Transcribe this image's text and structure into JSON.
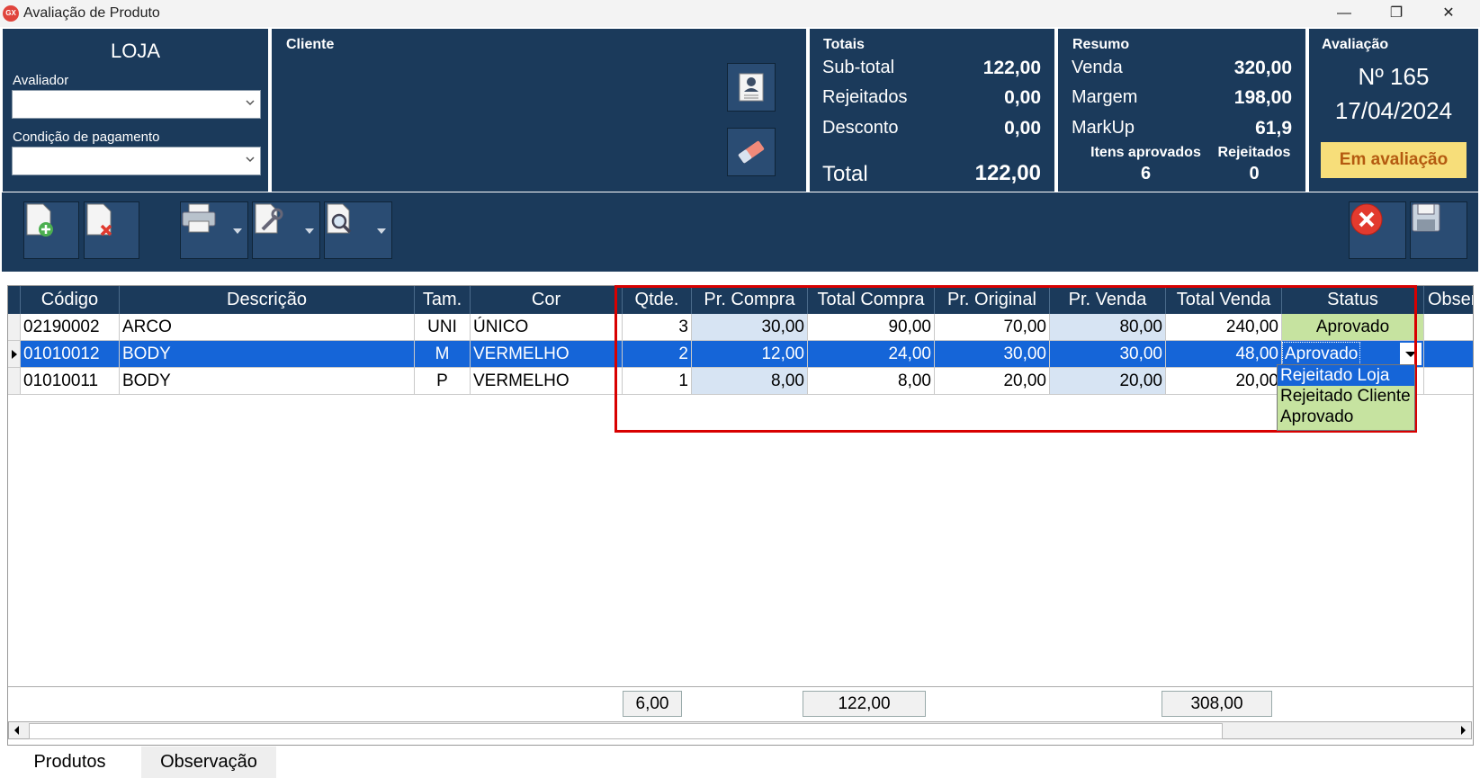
{
  "window": {
    "title": "Avaliação de Produto",
    "app_icon_text": "GX"
  },
  "store": {
    "title": "LOJA",
    "evaluator_label": "Avaliador",
    "evaluator_value": "",
    "payment_label": "Condição de pagamento",
    "payment_value": ""
  },
  "client": {
    "label": "Cliente"
  },
  "totals": {
    "title": "Totais",
    "subtotal_label": "Sub-total",
    "subtotal_value": "122,00",
    "rejected_label": "Rejeitados",
    "rejected_value": "0,00",
    "discount_label": "Desconto",
    "discount_value": "0,00",
    "total_label": "Total",
    "total_value": "122,00"
  },
  "summary": {
    "title": "Resumo",
    "sale_label": "Venda",
    "sale_value": "320,00",
    "margin_label": "Margem",
    "margin_value": "198,00",
    "markup_label": "MarkUp",
    "markup_value": "61,9",
    "approved_label": "Itens aprovados",
    "approved_value": "6",
    "rejected_label": "Rejeitados",
    "rejected_value": "0"
  },
  "evaluation": {
    "title": "Avaliação",
    "number": "Nº 165",
    "date": "17/04/2024",
    "status": "Em avaliação"
  },
  "grid": {
    "headers": [
      "Código",
      "Descrição",
      "Tam.",
      "Cor",
      "Qtde.",
      "Pr. Compra",
      "Total Compra",
      "Pr. Original",
      "Pr. Venda",
      "Total Venda",
      "Status",
      "Observ"
    ],
    "rows": [
      {
        "codigo": "02190002",
        "descricao": "ARCO",
        "tam": "UNI",
        "cor": "ÚNICO",
        "qtde": "3",
        "pr_compra": "30,00",
        "total_compra": "90,00",
        "pr_original": "70,00",
        "pr_venda": "80,00",
        "total_venda": "240,00",
        "status": "Aprovado"
      },
      {
        "codigo": "01010012",
        "descricao": "BODY",
        "tam": "M",
        "cor": "VERMELHO",
        "qtde": "2",
        "pr_compra": "12,00",
        "total_compra": "24,00",
        "pr_original": "30,00",
        "pr_venda": "30,00",
        "total_venda": "48,00",
        "status": "Aprovado"
      },
      {
        "codigo": "01010011",
        "descricao": "BODY",
        "tam": "P",
        "cor": "VERMELHO",
        "qtde": "1",
        "pr_compra": "8,00",
        "total_compra": "8,00",
        "pr_original": "20,00",
        "pr_venda": "20,00",
        "total_venda": "20,00",
        "status": ""
      }
    ],
    "status_options": [
      "Rejeitado Loja",
      "Rejeitado Cliente",
      "Aprovado"
    ],
    "footer": {
      "qtde_total": "6,00",
      "total_compra": "122,00",
      "total_venda": "308,00"
    }
  },
  "tabs": [
    "Produtos",
    "Observação"
  ],
  "colors": {
    "panel": "#1b3a5b",
    "accent": "#1565d8",
    "status_badge": "#f7de7a",
    "highlight_box": "#d80000"
  }
}
